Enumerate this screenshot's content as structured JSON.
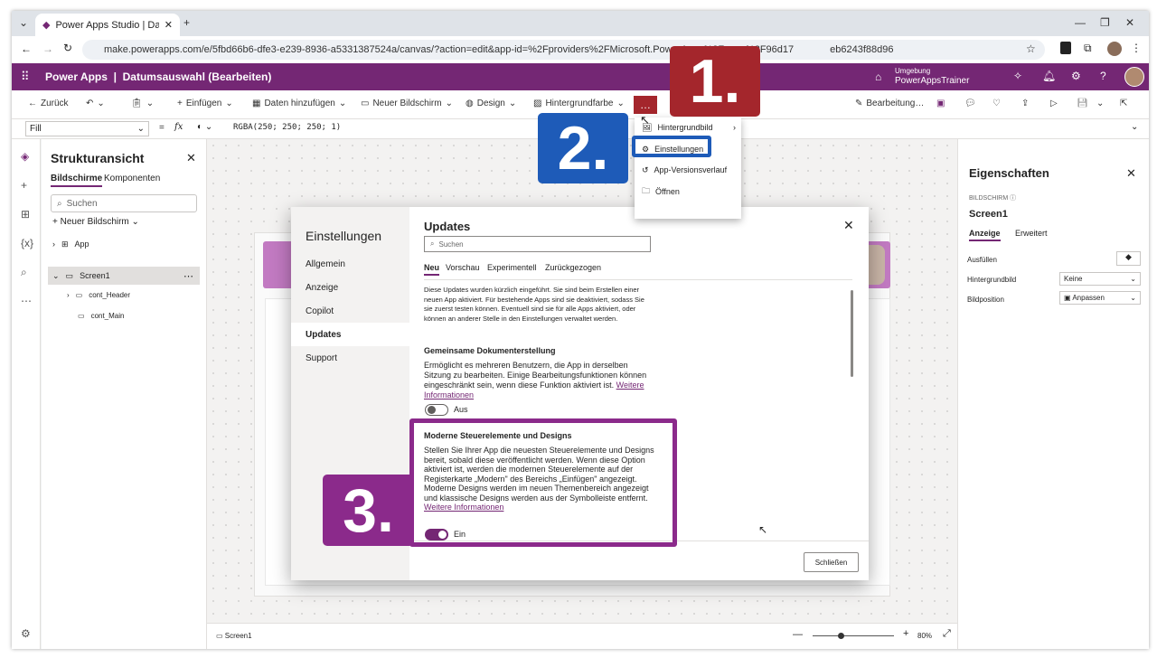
{
  "browser": {
    "tab_title": "Power Apps Studio | Datumsa…",
    "url": "make.powerapps.com/e/5fbd66b6-dfe3-e239-8936-a5331387524a/canvas/?action=edit&app-id=%2Fproviders%2FMicrosoft.PowerApps%2Fapps%2F96d17",
    "url_tail": "eb6243f88d96"
  },
  "app": {
    "brand": "Power Apps",
    "app_title": "Datumsauswahl (Bearbeiten)",
    "env_label": "Umgebung",
    "env_name": "PowerAppsTrainer"
  },
  "commands": {
    "back": "Zurück",
    "insert": "Einfügen",
    "add_data": "Daten hinzufügen",
    "new_screen": "Neuer Bildschirm",
    "design": "Design",
    "bg_color": "Hintergrundfarbe",
    "more": "…",
    "editing": "Bearbeitung…"
  },
  "formula": {
    "property": "Fill",
    "eq": "=",
    "fx": "fx",
    "value": "RGBA(250; 250; 250; 1)"
  },
  "menu": {
    "items": [
      "Hintergrundbild",
      "Einstellungen",
      "App-Versionsverlauf",
      "Öffnen"
    ]
  },
  "tree": {
    "title": "Strukturansicht",
    "tabs": [
      "Bildschirme",
      "Komponenten"
    ],
    "search_placeholder": "Suchen",
    "new_screen": "Neuer Bildschirm",
    "nodes": [
      "App",
      "Screen1",
      "cont_Header",
      "cont_Main"
    ]
  },
  "props": {
    "title": "Eigenschaften",
    "kind": "BILDSCHIRM",
    "name": "Screen1",
    "tabs": [
      "Anzeige",
      "Erweitert"
    ],
    "rows": [
      {
        "label": "Ausfüllen",
        "value": ""
      },
      {
        "label": "Hintergrundbild",
        "value": "Keine"
      },
      {
        "label": "Bildposition",
        "value": "Anpassen"
      }
    ]
  },
  "status": {
    "screen": "Screen1",
    "zoom": "80%"
  },
  "dialog": {
    "nav_title": "Einstellungen",
    "nav_items": [
      "Allgemein",
      "Anzeige",
      "Copilot",
      "Updates",
      "Support"
    ],
    "title": "Updates",
    "search_placeholder": "Suchen",
    "tabs": [
      "Neu",
      "Vorschau",
      "Experimentell",
      "Zurückgezogen"
    ],
    "intro": "Diese Updates wurden kürzlich eingeführt. Sie sind beim Erstellen einer neuen App aktiviert. Für bestehende Apps sind sie deaktiviert, sodass Sie sie zuerst testen können. Eventuell sind sie für alle Apps aktiviert, oder können an anderer Stelle in den Einstellungen verwaltet werden.",
    "f1_title": "Gemeinsame Dokumenterstellung",
    "f1_text": "Ermöglicht es mehreren Benutzern, die App in derselben Sitzung zu bearbeiten. Einige Bearbeitungsfunktionen können eingeschränkt sein, wenn diese Funktion aktiviert ist.",
    "f1_link": "Weitere Informationen",
    "f1_state": "Aus",
    "f2_title": "Moderne Steuerelemente und Designs",
    "f2_text": "Stellen Sie Ihrer App die neuesten Steuerelemente und Designs bereit, sobald diese veröffentlicht werden. Wenn diese Option aktiviert ist, werden die modernen Steuerelemente auf der Registerkarte „Modern\" des Bereichs „Einfügen\" angezeigt. Moderne Designs werden im neuen Themenbereich angezeigt und klassische Designs werden aus der Symbolleiste entfernt.",
    "f2_link": "Weitere Informationen",
    "f2_state": "Ein",
    "close": "Schließen"
  },
  "badges": [
    "1.",
    "2.",
    "3."
  ],
  "colors": {
    "brand": "#742774",
    "badge_red": "#a4262c",
    "badge_blue": "#1e5bb8",
    "badge_purple": "#8b2a8b"
  }
}
